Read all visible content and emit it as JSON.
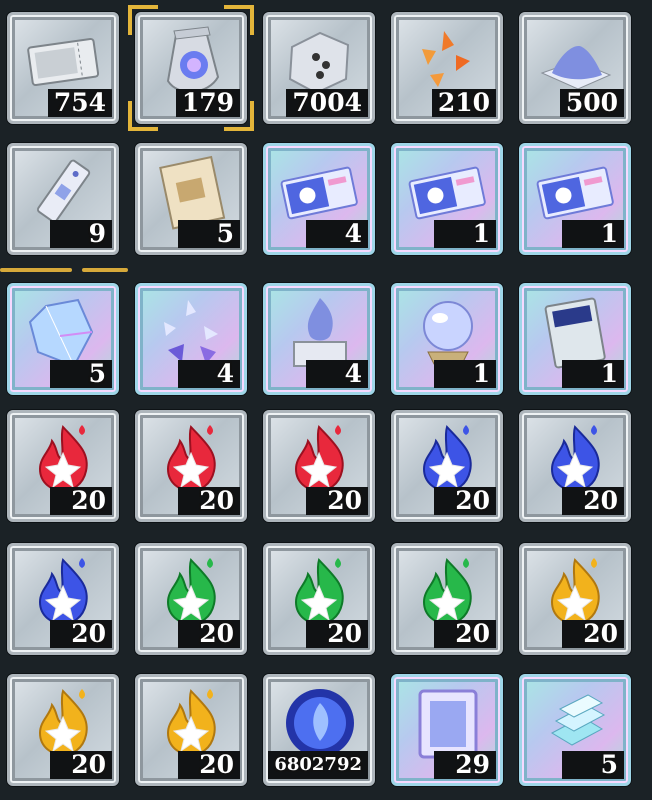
{
  "colors": {
    "background": "#1b2226",
    "selected_frame": "#e3b53a",
    "quantity_box": "#101214"
  },
  "items": [
    {
      "icon": "ticket-icon",
      "qty": "754",
      "rare": false,
      "selected": false
    },
    {
      "icon": "crystal-pouch-icon",
      "qty": "179",
      "rare": false,
      "selected": true
    },
    {
      "icon": "dice-box-icon",
      "qty": "7004",
      "rare": false,
      "selected": false
    },
    {
      "icon": "orange-shards-icon",
      "qty": "210",
      "rare": false,
      "selected": false
    },
    {
      "icon": "blue-powder-icon",
      "qty": "500",
      "rare": false,
      "selected": false
    },
    {
      "icon": "bookmark-icon",
      "qty": "9",
      "rare": false,
      "selected": false
    },
    {
      "icon": "map-scroll-icon",
      "qty": "5",
      "rare": false,
      "selected": false
    },
    {
      "icon": "summon-ticket-icon",
      "qty": "4",
      "rare": true,
      "selected": false
    },
    {
      "icon": "summon-ticket-icon",
      "qty": "1",
      "rare": true,
      "selected": false
    },
    {
      "icon": "summon-ticket-icon",
      "qty": "1",
      "rare": true,
      "selected": false
    },
    {
      "icon": "rainbow-crystal-icon",
      "qty": "5",
      "rare": true,
      "selected": false
    },
    {
      "icon": "crystal-fragments-icon",
      "qty": "4",
      "rare": true,
      "selected": false
    },
    {
      "icon": "flame-statue-icon",
      "qty": "4",
      "rare": true,
      "selected": false
    },
    {
      "icon": "orb-stand-icon",
      "qty": "1",
      "rare": true,
      "selected": false
    },
    {
      "icon": "sp-book-icon",
      "qty": "1",
      "rare": true,
      "selected": false
    },
    {
      "icon": "red-flame-icon",
      "qty": "20",
      "rare": false,
      "selected": false
    },
    {
      "icon": "red-flame-icon",
      "qty": "20",
      "rare": false,
      "selected": false
    },
    {
      "icon": "red-flame-icon",
      "qty": "20",
      "rare": false,
      "selected": false
    },
    {
      "icon": "blue-flame-icon",
      "qty": "20",
      "rare": false,
      "selected": false
    },
    {
      "icon": "blue-flame-icon",
      "qty": "20",
      "rare": false,
      "selected": false
    },
    {
      "icon": "blue-flame-icon",
      "qty": "20",
      "rare": false,
      "selected": false
    },
    {
      "icon": "green-flame-icon",
      "qty": "20",
      "rare": false,
      "selected": false
    },
    {
      "icon": "green-flame-icon",
      "qty": "20",
      "rare": false,
      "selected": false
    },
    {
      "icon": "green-flame-icon",
      "qty": "20",
      "rare": false,
      "selected": false
    },
    {
      "icon": "gold-flame-icon",
      "qty": "20",
      "rare": false,
      "selected": false
    },
    {
      "icon": "gold-flame-icon",
      "qty": "20",
      "rare": false,
      "selected": false
    },
    {
      "icon": "gold-flame-icon",
      "qty": "20",
      "rare": false,
      "selected": false
    },
    {
      "icon": "blue-orb-icon",
      "qty": "6802792",
      "rare": false,
      "selected": false
    },
    {
      "icon": "portal-frame-icon",
      "qty": "29",
      "rare": true,
      "selected": false
    },
    {
      "icon": "crystal-stack-icon",
      "qty": "5",
      "rare": true,
      "selected": false
    }
  ]
}
